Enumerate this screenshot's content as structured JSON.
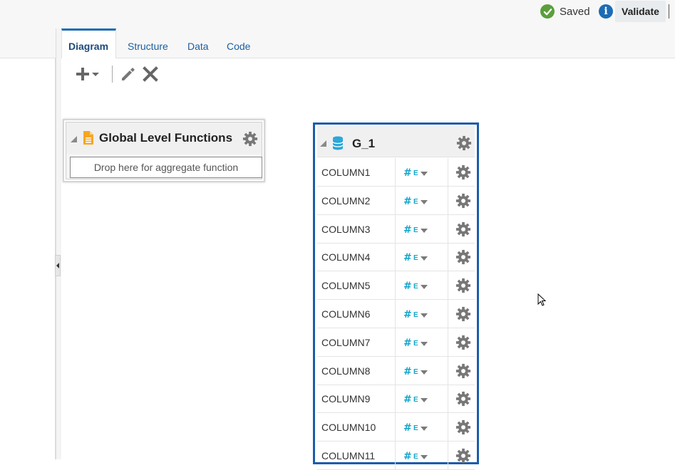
{
  "header": {
    "status_label": "Saved",
    "info_icon_text": "i",
    "validate_label": "Validate"
  },
  "tabs": [
    {
      "label": "Diagram",
      "active": true
    },
    {
      "label": "Structure",
      "active": false
    },
    {
      "label": "Data",
      "active": false
    },
    {
      "label": "Code",
      "active": false
    }
  ],
  "toolbar": {
    "icons": [
      "add-icon",
      "chevron-down-icon",
      "edit-icon",
      "delete-icon"
    ]
  },
  "global_functions": {
    "title": "Global Level Functions",
    "drop_placeholder": "Drop here for aggregate function"
  },
  "group": {
    "title": "G_1",
    "columns": [
      {
        "name": "COLUMN1"
      },
      {
        "name": "COLUMN2"
      },
      {
        "name": "COLUMN3"
      },
      {
        "name": "COLUMN4"
      },
      {
        "name": "COLUMN5"
      },
      {
        "name": "COLUMN6"
      },
      {
        "name": "COLUMN7"
      },
      {
        "name": "COLUMN8"
      },
      {
        "name": "COLUMN9"
      },
      {
        "name": "COLUMN10"
      },
      {
        "name": "COLUMN11"
      }
    ],
    "type_icon": "number-type-icon"
  },
  "colors": {
    "accent": "#1c6cb5",
    "group_border": "#1c5cab",
    "saved_green": "#5a9f3c",
    "type_icon": "#14a6c9",
    "document_icon": "#f6a623",
    "db_icon": "#2aa6d9"
  }
}
